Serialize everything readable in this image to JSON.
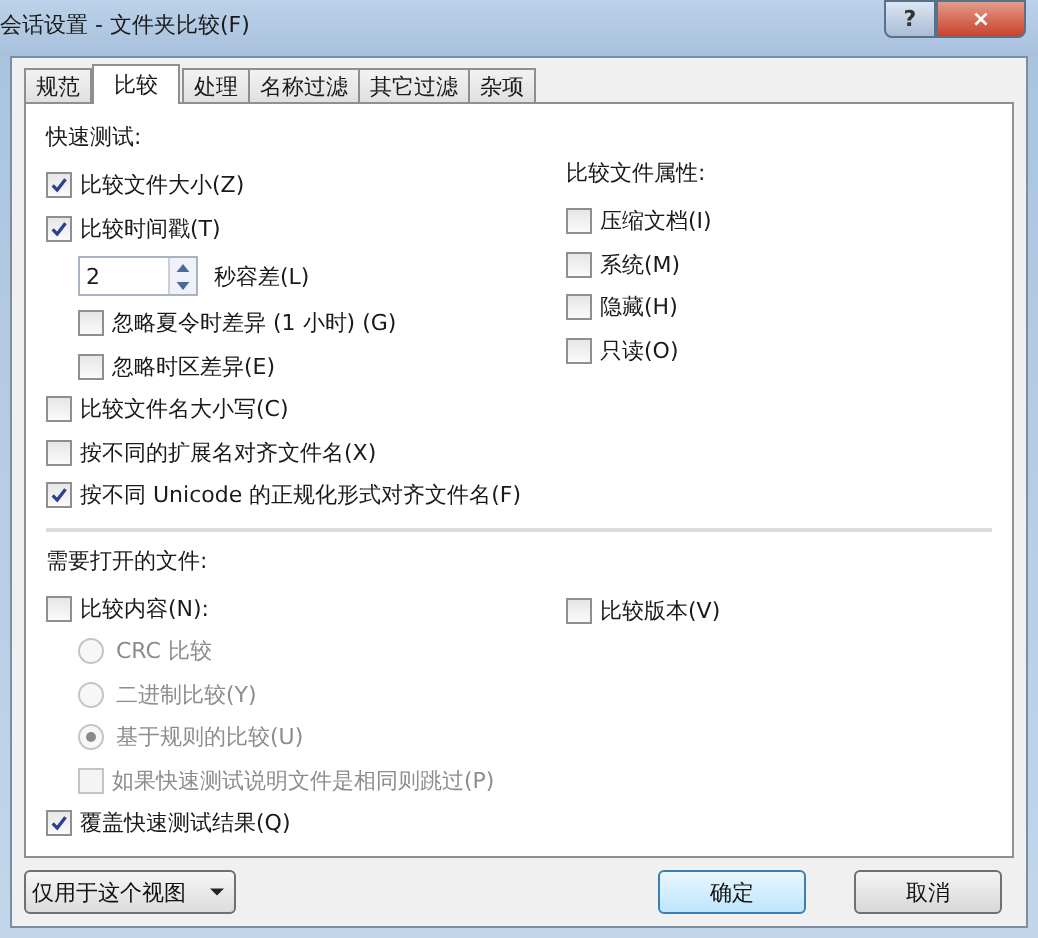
{
  "window": {
    "title": "会话设置 - 文件夹比较(F)",
    "help": "?",
    "close": "×"
  },
  "tabs": [
    {
      "label": "规范",
      "selected": false
    },
    {
      "label": "比较",
      "selected": true
    },
    {
      "label": "处理",
      "selected": false
    },
    {
      "label": "名称过滤",
      "selected": false
    },
    {
      "label": "其它过滤",
      "selected": false
    },
    {
      "label": "杂项",
      "selected": false
    }
  ],
  "sections": [
    {
      "title": "快速测试:",
      "left": [
        {
          "kind": "checkbox",
          "label": "比较文件大小(Z)",
          "checked": true,
          "disabled": false
        },
        {
          "kind": "checkbox",
          "label": "比较时间戳(T)",
          "checked": true,
          "disabled": false,
          "children": [
            {
              "kind": "spinner",
              "value": "2",
              "suffix": "秒容差(L)"
            },
            {
              "kind": "checkbox",
              "label": "忽略夏令时差异 (1 小时) (G)",
              "checked": false,
              "disabled": false
            },
            {
              "kind": "checkbox",
              "label": "忽略时区差异(E)",
              "checked": false,
              "disabled": false
            }
          ]
        },
        {
          "kind": "checkbox",
          "label": "比较文件名大小写(C)",
          "checked": false,
          "disabled": false
        },
        {
          "kind": "checkbox",
          "label": "按不同的扩展名对齐文件名(X)",
          "checked": false,
          "disabled": false
        },
        {
          "kind": "checkbox",
          "label": "按不同 Unicode 的正规化形式对齐文件名(F)",
          "checked": true,
          "disabled": false
        }
      ],
      "right_title": "比较文件属性:",
      "right": [
        {
          "kind": "checkbox",
          "label": "压缩文档(I)",
          "checked": false,
          "disabled": false
        },
        {
          "kind": "checkbox",
          "label": "系统(M)",
          "checked": false,
          "disabled": false
        },
        {
          "kind": "checkbox",
          "label": "隐藏(H)",
          "checked": false,
          "disabled": false
        },
        {
          "kind": "checkbox",
          "label": "只读(O)",
          "checked": false,
          "disabled": false
        }
      ]
    },
    {
      "title": "需要打开的文件:",
      "left": [
        {
          "kind": "checkbox",
          "label": "比较内容(N):",
          "checked": false,
          "disabled": false,
          "children": [
            {
              "kind": "radio",
              "label": "CRC 比较",
              "selected": false,
              "disabled": true
            },
            {
              "kind": "radio",
              "label": "二进制比较(Y)",
              "selected": false,
              "disabled": true
            },
            {
              "kind": "radio",
              "label": "基于规则的比较(U)",
              "selected": true,
              "disabled": true
            },
            {
              "kind": "checkbox",
              "label": "如果快速测试说明文件是相同则跳过(P)",
              "checked": false,
              "disabled": true
            }
          ]
        },
        {
          "kind": "checkbox",
          "label": "覆盖快速测试结果(Q)",
          "checked": true,
          "disabled": false
        }
      ],
      "right": [
        {
          "kind": "checkbox",
          "label": "比较版本(V)",
          "checked": false,
          "disabled": false
        }
      ]
    }
  ],
  "scope_dropdown": {
    "value": "仅用于这个视图"
  },
  "buttons": [
    {
      "label": "确定",
      "default": true
    },
    {
      "label": "取消",
      "default": false
    }
  ]
}
